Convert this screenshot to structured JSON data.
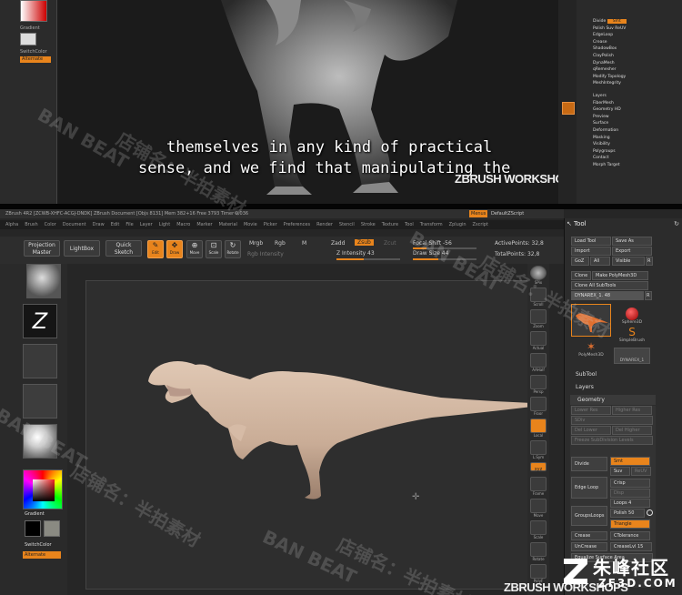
{
  "top_frame": {
    "subtitle_line1": "themselves in any kind of practical",
    "subtitle_line2": "sense, and we find that manipulating the",
    "zbrush_logo": "ZBRUSH WORKSHOPS",
    "left_labels": {
      "gradient": "Gradient",
      "switch": "SwitchColor",
      "alternate": "Alternate"
    },
    "right_menu": [
      "Polish",
      "SmoothSubdiv",
      "EdgeLoop",
      "Crease",
      "ShadowBox",
      "ClayPolish",
      "DynaMesh",
      "qRemesher",
      "Modify Topology",
      "MeshIntegrity",
      "Layers",
      "FiberMesh",
      "Geometry HD",
      "Preview",
      "Surface",
      "Deformation",
      "Masking",
      "Visibility",
      "Polygroups",
      "Contact",
      "Morph Target"
    ],
    "right_menu_top": [
      "Divide",
      "Smt",
      "Suv",
      "ReUV"
    ]
  },
  "app": {
    "menubar": [
      "Alpha",
      "Brush",
      "Color",
      "Document",
      "Draw",
      "Edit",
      "File",
      "Layer",
      "Light",
      "Macro",
      "Marker",
      "Material",
      "Movie",
      "Picker",
      "Preferences",
      "Render",
      "Stencil",
      "Stroke",
      "Texture",
      "Tool",
      "Transform",
      "Zplugin",
      "Zscript"
    ],
    "titlebar": "ZBrush 4R2   [ZCWB-XHFC-ACGJ-DNDK]   ZBrush Document   [Objs 8131]  Mem 382+16  Free 3793  Timer 0.036",
    "menu_right": [
      "Menus",
      "DefaultZScript"
    ],
    "toolbar": {
      "projection_master": "Projection Master",
      "lightbox": "LightBox",
      "quick_sketch": "Quick Sketch",
      "edit": "Edit",
      "draw": "Draw",
      "move": "Move",
      "scale": "Scale",
      "rotate": "Rotate",
      "mrgb": "Mrgb",
      "rgb": "Rgb",
      "m": "M",
      "zadd": "Zadd",
      "zsub": "Zsub",
      "zcut": "Zcut",
      "rgb_intensity": "Rgb Intensity",
      "z_intensity": "Z Intensity 43",
      "focal_shift": "Focal Shift -56",
      "draw_size": "Draw Size 44",
      "active_points": "ActivePoints: 32,8",
      "total_points": "TotalPoints: 32,8"
    },
    "left_panel": {
      "gradient": "Gradient",
      "switch_color": "SwitchColor",
      "alternate": "Alternate"
    },
    "right_shelf": [
      "SPix",
      "Scroll",
      "Zoom",
      "Actual",
      "AAHalf",
      "Persp",
      "Floor",
      "Local",
      "L.Sym",
      "xyz",
      "Frame",
      "Move",
      "Scale",
      "Rotate",
      "PolyF"
    ],
    "tool_panel": {
      "title": "Tool",
      "load_tool": "Load Tool",
      "save_as": "Save As",
      "import": "Import",
      "export": "Export",
      "goz": "GoZ",
      "all": "All",
      "visible": "Visible",
      "r": "R",
      "clone": "Clone",
      "make_polymesh": "Make PolyMesh3D",
      "clone_all": "Clone All SubTools",
      "current_tool": "DYNAREX_1. 48",
      "tools": [
        "Sphere3D",
        "SimpleBrush",
        "PolyMesh3D",
        "DYNAREX_1"
      ],
      "subtool": "SubTool",
      "layers": "Layers",
      "geometry": "Geometry",
      "lower_res": "Lower Res",
      "higher_res": "Higher Res",
      "sdiv": "SDiv",
      "del_lower": "Del Lower",
      "del_higher": "Del Higher",
      "freeze": "Freeze SubDivision Levels",
      "divide": "Divide",
      "smt": "Smt",
      "suv": "Suv",
      "reuv": "ReUV",
      "edge_loop": "Edge Loop",
      "crisp": "Crisp",
      "disp": "Disp",
      "loops": "Loops 4",
      "group_loops": "GroupsLoops",
      "polish": "Polish 50",
      "triangle": "Triangle",
      "crease": "Crease",
      "ctolerance": "CTolerance",
      "uncrease": "UnCrease",
      "crease_lvl": "CreaseLvl 15",
      "equalize": "Equalize Surface Area"
    }
  },
  "watermarks": {
    "cn_text": "店铺名：半拍素材",
    "ban_beat": "BAN BEAT",
    "site_cn": "朱峰社区",
    "site_url": "ZF3D.COM",
    "zbrush_logo": "ZBRUSH WORKSHOPS"
  },
  "colors": {
    "accent": "#e8841c",
    "model": "#d4b8a4"
  }
}
